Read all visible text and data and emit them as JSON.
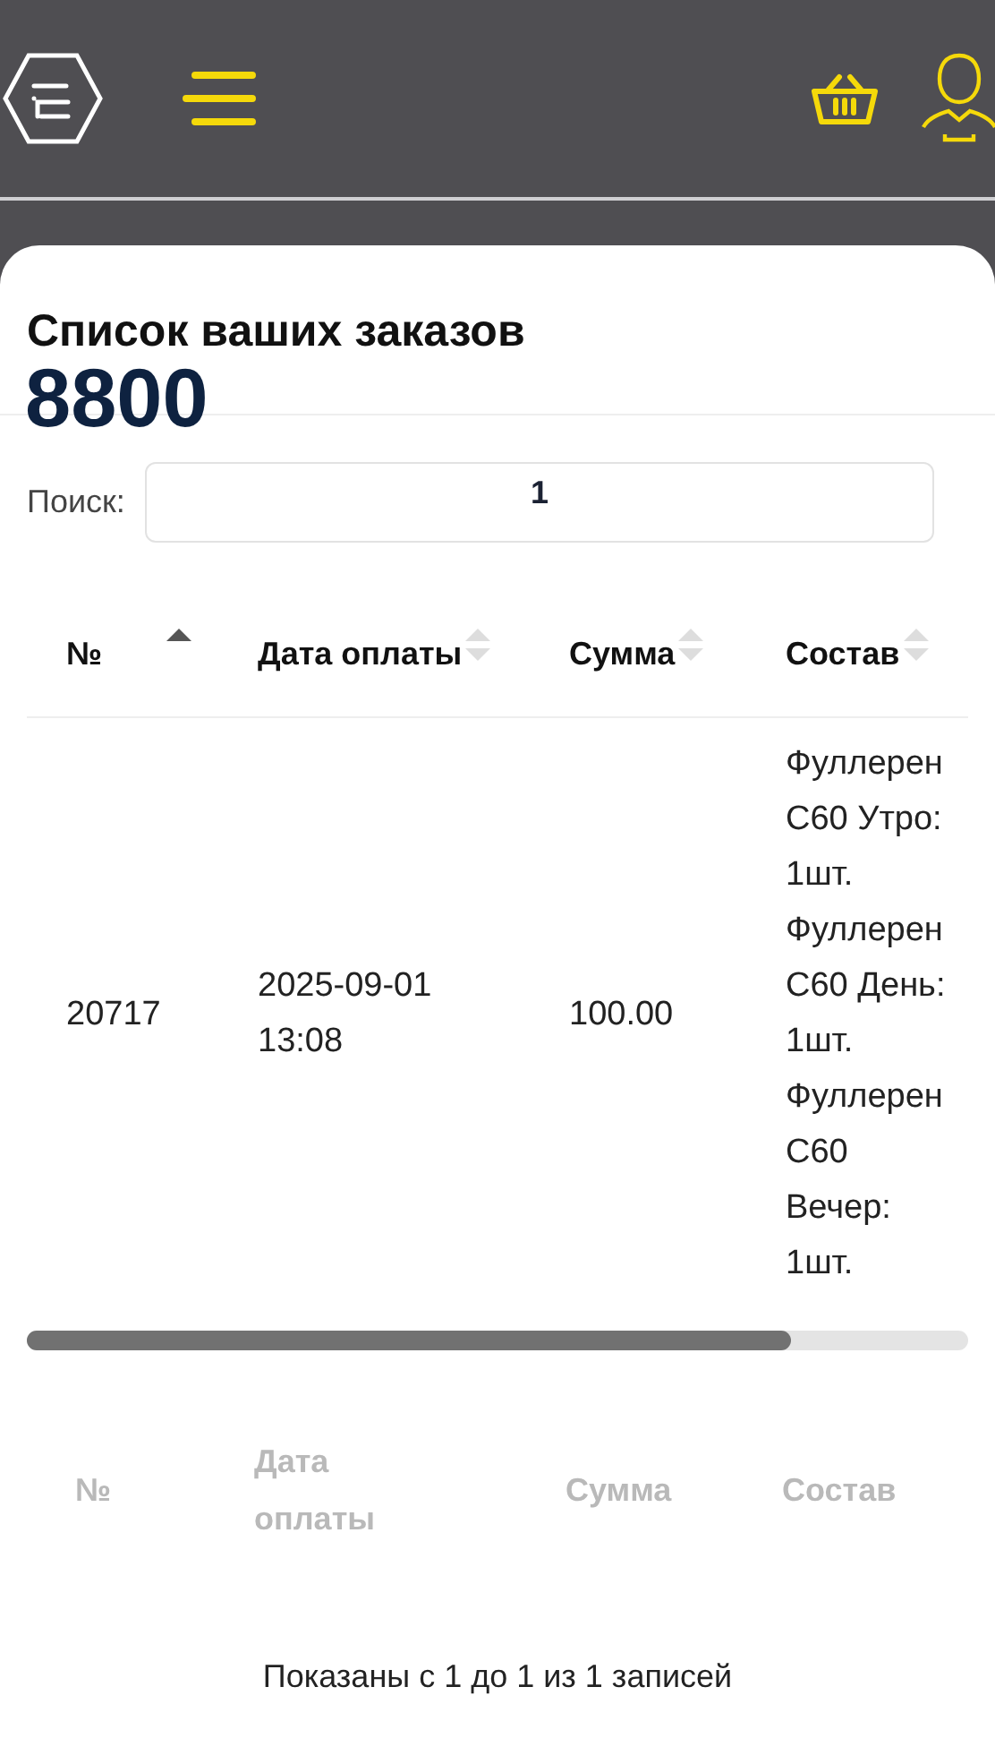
{
  "title": "Список ваших заказов",
  "phone": "8800",
  "search": {
    "label": "Поиск:",
    "value": "1"
  },
  "table": {
    "columns": [
      {
        "label": "№",
        "sorted": true
      },
      {
        "label": "Дата оплаты",
        "sorted": false
      },
      {
        "label": "Сумма",
        "sorted": false
      },
      {
        "label": "Состав",
        "sorted": false
      }
    ],
    "rows": [
      [
        "20717",
        "2025-09-01 13:08",
        "100.00",
        "Фуллерен C60 Утро: 1шт. Фуллерен C60 День: 1шт. Фуллерен C60 Вечер: 1шт."
      ]
    ],
    "footer_columns": [
      "№",
      "Дата оплаты",
      "Сумма",
      "Состав"
    ]
  },
  "info": "Показаны с 1 до 1 из 1 записей"
}
